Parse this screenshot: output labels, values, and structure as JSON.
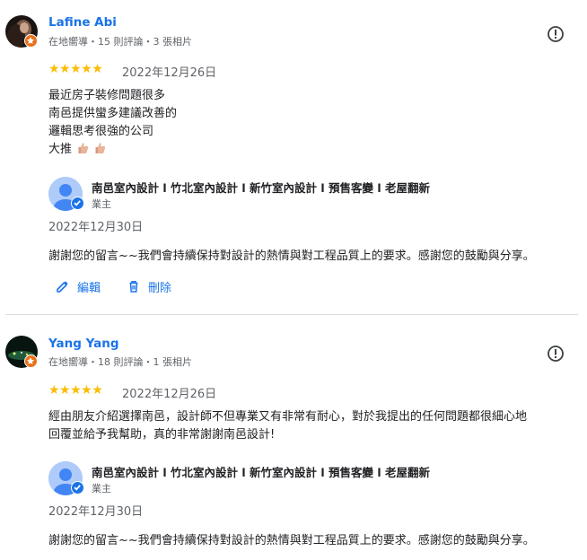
{
  "reviews": [
    {
      "reviewer_name": "Lafine Abi",
      "reviewer_meta": "在地嚮導・15 則評論・3 張相片",
      "stars": "★★★★★",
      "rating": 5,
      "date": "2022年12月26日",
      "text_lines": [
        "最近房子裝修問題很多",
        "南邑提供蠻多建議改善的",
        "邏輯思考很強的公司",
        "大推"
      ],
      "emoji_icon": "thumbs-up-emoji",
      "owner_reply": {
        "owner_name": "南邑室內設計 l 竹北室內設計 l 新竹室內設計 l 預售客變 l 老屋翻新",
        "owner_role": "業主",
        "date": "2022年12月30日",
        "text": "謝謝您的留言~~我們會持續保持對設計的熱情與對工程品質上的要求。感謝您的鼓勵與分享。"
      },
      "actions": {
        "edit_label": "編輯",
        "delete_label": "刪除"
      }
    },
    {
      "reviewer_name": "Yang Yang",
      "reviewer_meta": "在地嚮導・18 則評論・1 張相片",
      "stars": "★★★★★",
      "rating": 5,
      "date": "2022年12月26日",
      "text_lines": [
        "經由朋友介紹選擇南邑，設計師不但專業又有非常有耐心，對於我提出的任何問題都很細心地",
        "回覆並給予我幫助，真的非常謝謝南邑設計!"
      ],
      "owner_reply": {
        "owner_name": "南邑室內設計 l 竹北室內設計 l 新竹室內設計 l 預售客變 l 老屋翻新",
        "owner_role": "業主",
        "date": "2022年12月30日",
        "text": "謝謝您的留言~~我們會持續保持對設計的熱情與對工程品質上的要求。感謝您的鼓勵與分享。"
      }
    }
  ],
  "colors": {
    "link_blue": "#1a73e8",
    "star_yellow": "#fbbc04",
    "local_guide_orange": "#e8711a",
    "secondary_text": "#5f6368",
    "divider": "#dadce0"
  },
  "icons": [
    "report-icon",
    "local-guide-badge-icon",
    "verified-owner-icon",
    "edit-pencil-icon",
    "delete-trash-icon",
    "thumbs-up-emoji"
  ]
}
